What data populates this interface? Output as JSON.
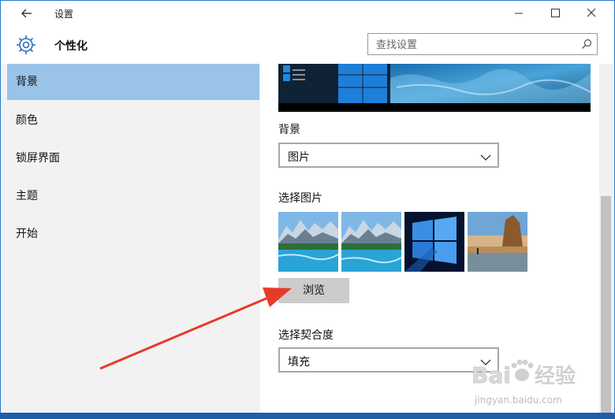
{
  "window": {
    "title": "设置"
  },
  "header": {
    "title": "个性化",
    "search_placeholder": "查找设置"
  },
  "sidebar": {
    "items": [
      {
        "label": "背景",
        "selected": true
      },
      {
        "label": "颜色",
        "selected": false
      },
      {
        "label": "锁屏界面",
        "selected": false
      },
      {
        "label": "主题",
        "selected": false
      },
      {
        "label": "开始",
        "selected": false
      }
    ]
  },
  "content": {
    "background_label": "背景",
    "background_value": "图片",
    "choose_picture_label": "选择图片",
    "browse_label": "浏览",
    "fit_label": "选择契合度",
    "fit_value": "填充"
  },
  "watermark": {
    "brand": "Bai",
    "brand_cn": "经验",
    "url": "jingyan.baidu.com"
  },
  "colors": {
    "accent": "#0078d7",
    "selection": "#99c4e8",
    "sidebar_bg": "#f2f2f2",
    "annotation_arrow": "#e8392b"
  }
}
